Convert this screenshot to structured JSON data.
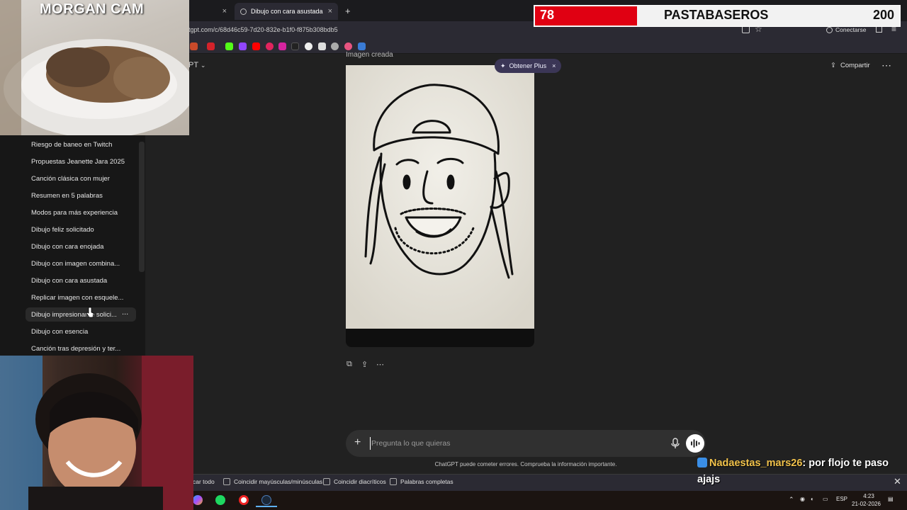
{
  "browser": {
    "tabs": [
      {
        "label": "",
        "active": false
      },
      {
        "label": "Dibujo con cara asustada",
        "active": true
      }
    ],
    "new_tab_icon": "plus-icon",
    "url": "tgpt.com/c/68d46c59-7d20-832e-b1f0-f875b308bdb5",
    "signin_label": "Conectarse"
  },
  "sidebar": {
    "items": [
      "Riesgo de baneo en Twitch",
      "Propuestas Jeanette Jara 2025",
      "Canción clásica con mujer",
      "Resumen en 5 palabras",
      "Modos para más experiencia",
      "Dibujo feliz solicitado",
      "Dibujo con cara enojada",
      "Dibujo con imagen combina...",
      "Dibujo con cara asustada",
      "Replicar imagen con esquele...",
      "Dibujo impresionante solici...",
      "Dibujo con esencia",
      "Canción tras depresión y ter..."
    ],
    "hover_more": "..."
  },
  "main": {
    "model_label": "PT",
    "image_caption": "Imagen creada",
    "upgrade_pill": "Obtener Plus",
    "share_label": "Compartir",
    "composer_placeholder": "Pregunta lo que quieras",
    "disclaimer": "ChatGPT puede cometer errores. Comprueba la información importante."
  },
  "findbar": {
    "highlight_all": "car todo",
    "match_case": "Coincidir mayúsculas/minúsculas",
    "match_diacritics": "Coincidir diacríticos",
    "whole_words": "Palabras completas"
  },
  "taskbar": {
    "lang": "ESP",
    "time": "4:23",
    "date": "21-02-2026"
  },
  "stream": {
    "cam_title": "MORGAN CAM",
    "bar": {
      "left_value": "78",
      "team": "PASTABASEROS",
      "right_value": "200",
      "left_color": "#e00012"
    },
    "chat": {
      "user": "Nadaestas_mars26",
      "message": ": por flojo te paso ajajs"
    }
  }
}
